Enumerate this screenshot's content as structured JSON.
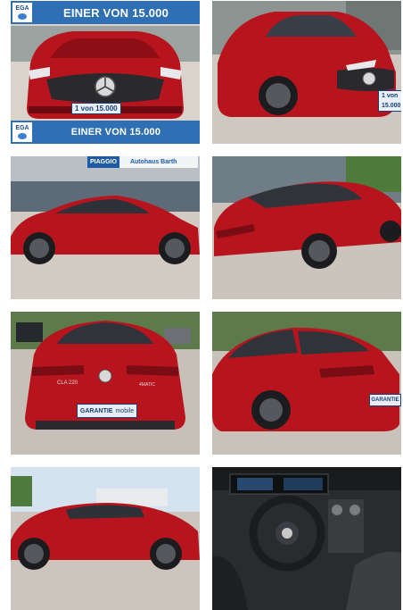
{
  "gallery": {
    "banner_text": "EINER VON 15.000",
    "badge_text": "EGA",
    "plate_promo": "1 von 15.000",
    "dealer_sign": "Autohaus Barth",
    "dealer_sign_brand": "PIAGGIO",
    "plate_rear": "GARANTIE",
    "plate_rear_sub": "mobile",
    "model_badge": "CLA 220",
    "variant_badge": "4MATIC"
  },
  "colors": {
    "car_red": "#b8141e",
    "banner_blue": "#2f6fb3",
    "pavement": "#cfc8c0"
  }
}
